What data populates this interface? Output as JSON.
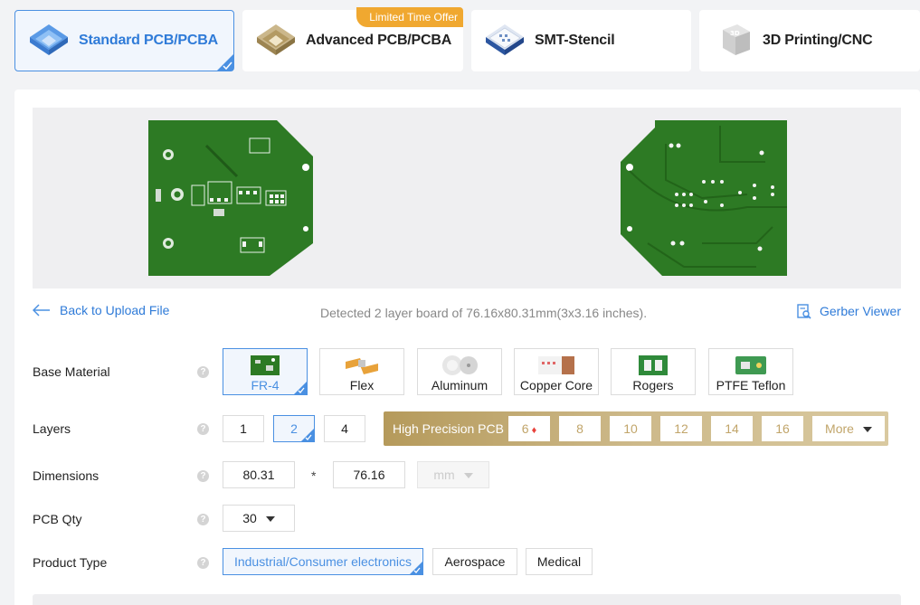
{
  "tabs": [
    {
      "label": "Standard PCB/PCBA",
      "icon": "standard-pcb-icon",
      "active": true
    },
    {
      "label": "Advanced PCB/PCBA",
      "icon": "advanced-pcb-icon",
      "badge": "Limited Time Offer"
    },
    {
      "label": "SMT-Stencil",
      "icon": "smt-stencil-icon"
    },
    {
      "label": "3D Printing/CNC",
      "icon": "3d-printing-icon"
    }
  ],
  "toolbar": {
    "back_label": "Back to Upload File",
    "detected_text": "Detected 2 layer board of 76.16x80.31mm(3x3.16 inches).",
    "gerber_label": "Gerber Viewer"
  },
  "base_material": {
    "label": "Base Material",
    "options": [
      "FR-4",
      "Flex",
      "Aluminum",
      "Copper Core",
      "Rogers",
      "PTFE Teflon"
    ],
    "selected": "FR-4"
  },
  "layers": {
    "label": "Layers",
    "options": [
      "1",
      "2",
      "4"
    ],
    "selected": "2",
    "high_precision": {
      "label": "High Precision PCB",
      "options": [
        "6",
        "8",
        "10",
        "12",
        "14",
        "16"
      ],
      "more_label": "More"
    }
  },
  "dimensions": {
    "label": "Dimensions",
    "width": "80.31",
    "separator": "*",
    "height": "76.16",
    "unit": "mm"
  },
  "pcb_qty": {
    "label": "PCB Qty",
    "value": "30"
  },
  "product_type": {
    "label": "Product Type",
    "options": [
      "Industrial/Consumer electronics",
      "Aerospace",
      "Medical"
    ],
    "selected": "Industrial/Consumer electronics"
  },
  "help_glyph": "?",
  "colors": {
    "accent": "#4a90e2",
    "pcb_green": "#2d7a24",
    "offer_orange": "#f0a830",
    "gold": "#c1a56a"
  }
}
